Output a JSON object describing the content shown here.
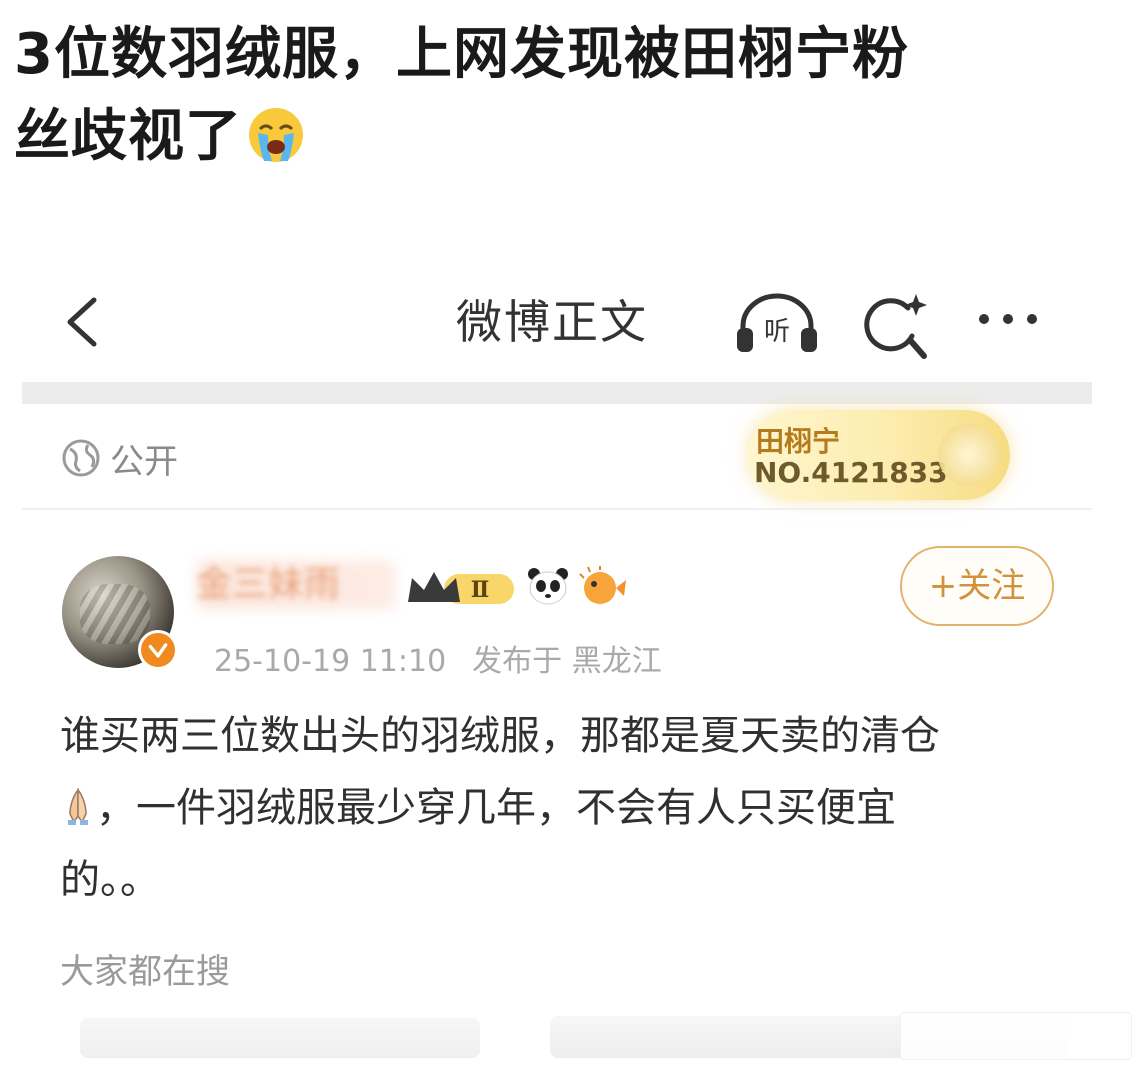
{
  "caption": {
    "line1": "3位数羽绒服，上网发现被田栩宁粉",
    "line2": "丝歧视了"
  },
  "topbar": {
    "title": "微博正文",
    "listen_label": "听"
  },
  "visibility": {
    "label": "公开"
  },
  "fan_badge": {
    "name": "田栩宁",
    "number": "NO.4121833"
  },
  "author": {
    "name": "金三妹雨",
    "vip_level": "Ⅱ",
    "follow_label": "+关注",
    "timestamp": "25-10-19 11:10",
    "location": "发布于 黑龙江"
  },
  "post": {
    "line1": "谁买两三位数出头的羽绒服，那都是夏天卖的清仓",
    "line2": "，一件羽绒服最少穿几年，不会有人只买便宜",
    "line3": "的。。"
  },
  "section": {
    "hot_search_label": "大家都在搜"
  },
  "colors": {
    "accent_orange": "#d4913b",
    "meta_gray": "#a9a9a9",
    "badge_gold": "#f6dc82"
  },
  "icons": {
    "back": "chevron-left-icon",
    "listen": "headphones-icon",
    "search": "search-sparkle-icon",
    "more": "more-dots-icon",
    "globe": "globe-icon",
    "verified": "verified-badge-icon",
    "crown": "crown-icon",
    "panda": "panda-icon",
    "puffer": "pufferfish-icon",
    "crying": "crying-face-icon",
    "pray": "pray-hands-icon"
  }
}
